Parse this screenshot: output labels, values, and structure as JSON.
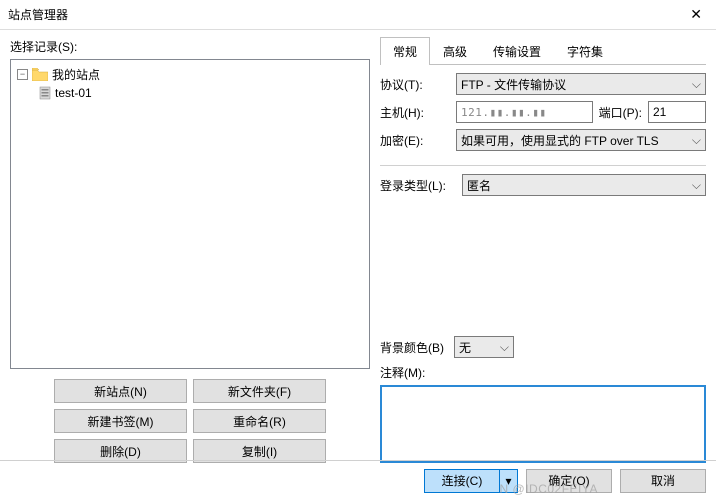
{
  "window": {
    "title": "站点管理器"
  },
  "left": {
    "select_label": "选择记录(S):",
    "root_node": "我的站点",
    "child_node": "test-01",
    "buttons": {
      "new_site": "新站点(N)",
      "new_folder": "新文件夹(F)",
      "new_bookmark": "新建书签(M)",
      "rename": "重命名(R)",
      "delete": "删除(D)",
      "copy": "复制(I)"
    }
  },
  "tabs": {
    "general": "常规",
    "advanced": "高级",
    "transfer": "传输设置",
    "charset": "字符集"
  },
  "form": {
    "protocol_label": "协议(T):",
    "protocol_value": "FTP - 文件传输协议",
    "host_label": "主机(H):",
    "host_value": "121.▮▮.▮▮.▮▮",
    "port_label": "端口(P):",
    "port_value": "21",
    "encryption_label": "加密(E):",
    "encryption_value": "如果可用，使用显式的 FTP over TLS",
    "login_type_label": "登录类型(L):",
    "login_type_value": "匿名",
    "bgcolor_label": "背景颜色(B)",
    "bgcolor_value": "无",
    "comment_label": "注释(M):"
  },
  "footer": {
    "connect": "连接(C)",
    "ok": "确定(O)",
    "cancel": "取消"
  },
  "watermark": "N @IDC02FEIYA"
}
